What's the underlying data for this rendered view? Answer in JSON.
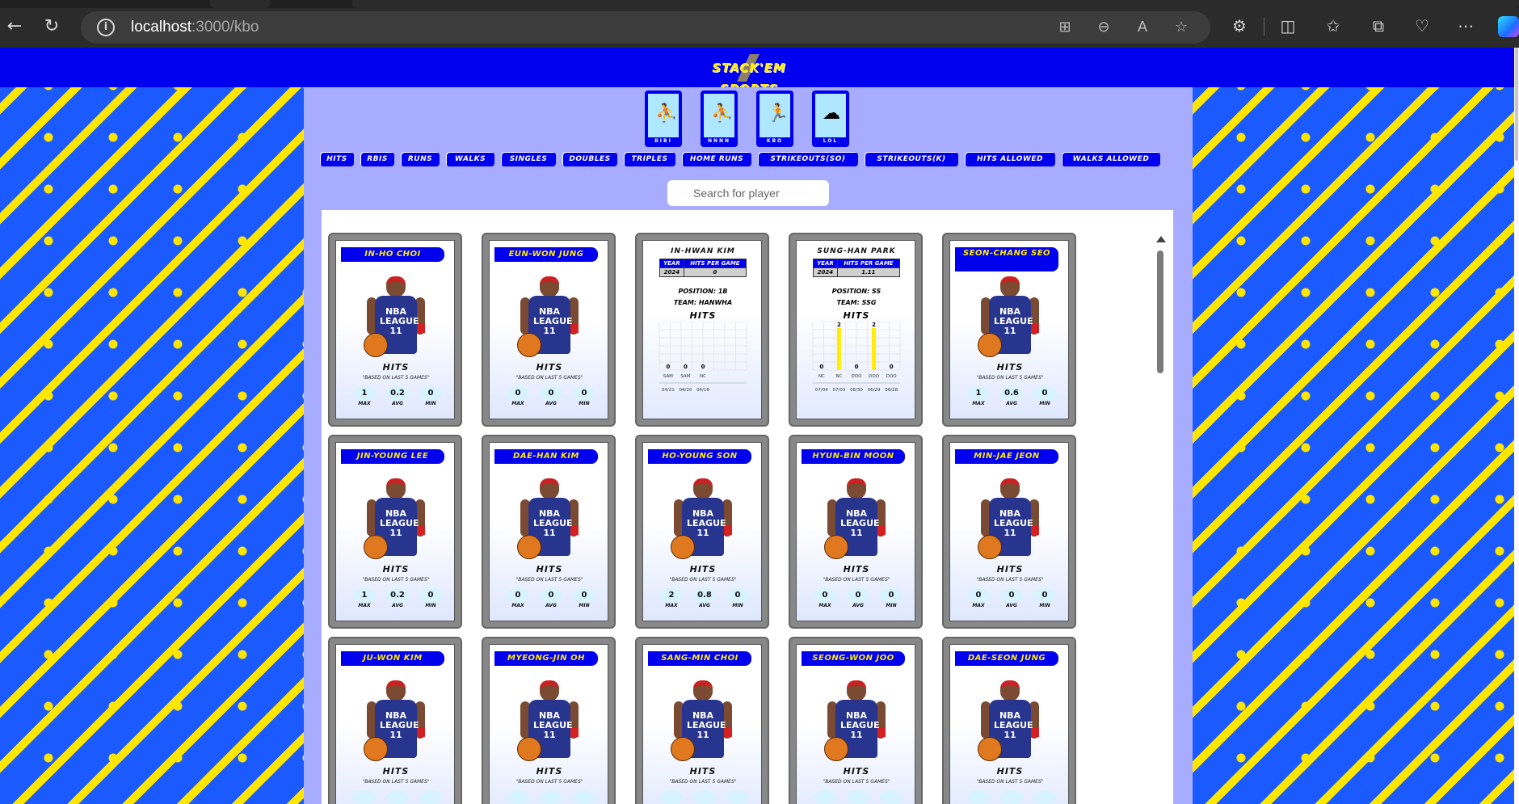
{
  "browser": {
    "url_host": "localhost",
    "url_path": ":3000/kbo"
  },
  "site": {
    "logo": "STACK'EM SPORTS"
  },
  "sports": [
    {
      "label": "BIBI",
      "icon": "basketball-player-icon"
    },
    {
      "label": "NNNN",
      "icon": "basketball-dunk-icon"
    },
    {
      "label": "KBO",
      "icon": "baseball-player-icon"
    },
    {
      "label": "LOL",
      "icon": "lol-icon"
    }
  ],
  "stat_tabs": [
    "HITS",
    "RBIS",
    "RUNS",
    "WALKS",
    "SINGLES",
    "DOUBLES",
    "TRIPLES",
    "HOME RUNS",
    "STRIKEOUTS(SO)",
    "STRIKEOUTS(K)",
    "HITS ALLOWED",
    "WALKS ALLOWED"
  ],
  "search": {
    "placeholder": "Search for player"
  },
  "labels": {
    "max": "MAX",
    "avg": "AVG",
    "min": "MIN",
    "note": "\"BASED ON LAST 5 GAMES\"",
    "stat": "HITS",
    "jersey": "NBA LEAGUE 11"
  },
  "cards": [
    {
      "name": "IN-HO CHOI",
      "max": "1",
      "avg": "0.2",
      "min": "0"
    },
    {
      "name": "EUN-WON JUNG",
      "max": "0",
      "avg": "0",
      "min": "0"
    },
    {
      "name": "IN-HWAN KIM",
      "back": true,
      "year_col": "YEAR",
      "val_col": "HITS PER GAME",
      "year": "2024",
      "value": "0",
      "position": "POSITION: 1B",
      "team": "TEAM: HANWHA",
      "chart_title": "HITS"
    },
    {
      "name": "SUNG-HAN PARK",
      "back": true,
      "year_col": "YEAR",
      "val_col": "HITS PER GAME",
      "year": "2024",
      "value": "1.11",
      "position": "POSITION: SS",
      "team": "TEAM: SSG",
      "chart_title": "HITS"
    },
    {
      "name": "SEON-CHANG SEO",
      "max": "1",
      "avg": "0.6",
      "min": "0"
    },
    {
      "name": "JIN-YOUNG LEE",
      "max": "1",
      "avg": "0.2",
      "min": "0"
    },
    {
      "name": "DAE-HAN KIM",
      "max": "0",
      "avg": "0",
      "min": "0"
    },
    {
      "name": "HO-YOUNG SON",
      "max": "2",
      "avg": "0.8",
      "min": "0"
    },
    {
      "name": "HYUN-BIN MOON",
      "max": "0",
      "avg": "0",
      "min": "0"
    },
    {
      "name": "MIN-JAE JEON",
      "max": "0",
      "avg": "0",
      "min": "0"
    },
    {
      "name": "JU-WON KIM",
      "max": "",
      "avg": "",
      "min": ""
    },
    {
      "name": "MYEONG-JIN OH",
      "max": "",
      "avg": "",
      "min": ""
    },
    {
      "name": "SANG-MIN CHOI",
      "max": "",
      "avg": "",
      "min": ""
    },
    {
      "name": "SEONG-WON JOO",
      "max": "",
      "avg": "",
      "min": ""
    },
    {
      "name": "DAE-SEON JUNG",
      "max": "",
      "avg": "",
      "min": ""
    }
  ],
  "chart_data": [
    {
      "type": "bar",
      "title": "HITS",
      "categories": [
        "04/21 SAM",
        "04/20 SAM",
        "04/18 NC"
      ],
      "series": [
        {
          "values": [
            0,
            0,
            0
          ]
        }
      ],
      "bar_color": "#ffee00",
      "grid": true
    },
    {
      "type": "bar",
      "title": "HITS",
      "categories": [
        "07/04 NC",
        "07/03 NC",
        "06/30 DOO",
        "06/29 DOO",
        "06/28 DOO"
      ],
      "series": [
        {
          "values": [
            0,
            2,
            0,
            2,
            0
          ]
        }
      ],
      "bar_color": "#ffee00",
      "grid": true
    }
  ]
}
